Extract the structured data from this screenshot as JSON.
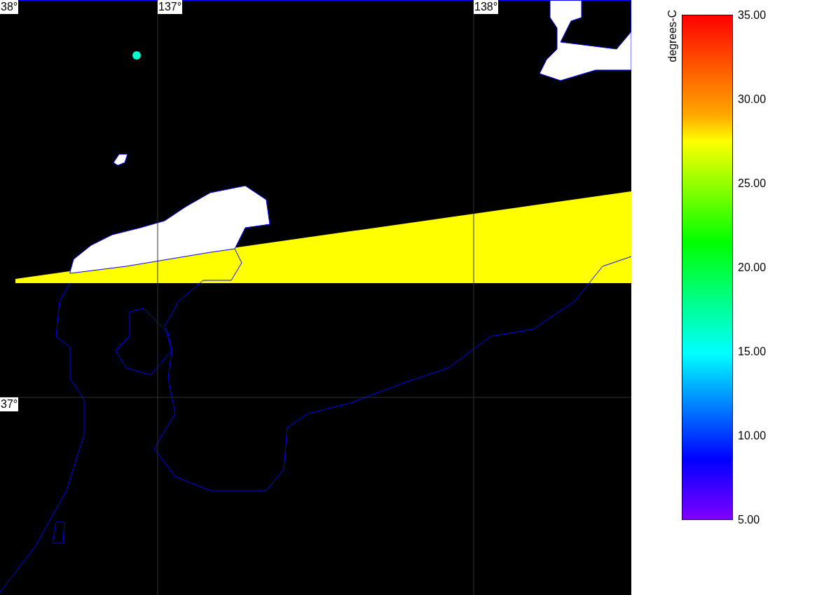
{
  "map": {
    "lat_labels": [
      "38°",
      "37°"
    ],
    "lon_labels": [
      "137°",
      "138°"
    ]
  },
  "legend": {
    "title": "degrees-C",
    "ticks": [
      "35.00",
      "30.00",
      "25.00",
      "20.00",
      "15.00",
      "10.00",
      "5.00"
    ]
  }
}
